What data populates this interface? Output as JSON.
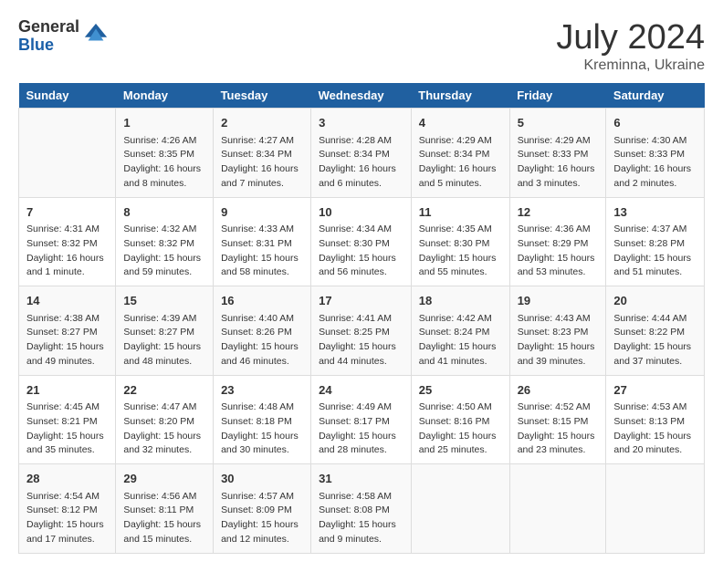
{
  "logo": {
    "general": "General",
    "blue": "Blue"
  },
  "title": "July 2024",
  "location": "Kreminna, Ukraine",
  "days_header": [
    "Sunday",
    "Monday",
    "Tuesday",
    "Wednesday",
    "Thursday",
    "Friday",
    "Saturday"
  ],
  "weeks": [
    [
      {
        "day": "",
        "info": ""
      },
      {
        "day": "1",
        "info": "Sunrise: 4:26 AM\nSunset: 8:35 PM\nDaylight: 16 hours\nand 8 minutes."
      },
      {
        "day": "2",
        "info": "Sunrise: 4:27 AM\nSunset: 8:34 PM\nDaylight: 16 hours\nand 7 minutes."
      },
      {
        "day": "3",
        "info": "Sunrise: 4:28 AM\nSunset: 8:34 PM\nDaylight: 16 hours\nand 6 minutes."
      },
      {
        "day": "4",
        "info": "Sunrise: 4:29 AM\nSunset: 8:34 PM\nDaylight: 16 hours\nand 5 minutes."
      },
      {
        "day": "5",
        "info": "Sunrise: 4:29 AM\nSunset: 8:33 PM\nDaylight: 16 hours\nand 3 minutes."
      },
      {
        "day": "6",
        "info": "Sunrise: 4:30 AM\nSunset: 8:33 PM\nDaylight: 16 hours\nand 2 minutes."
      }
    ],
    [
      {
        "day": "7",
        "info": "Sunrise: 4:31 AM\nSunset: 8:32 PM\nDaylight: 16 hours\nand 1 minute."
      },
      {
        "day": "8",
        "info": "Sunrise: 4:32 AM\nSunset: 8:32 PM\nDaylight: 15 hours\nand 59 minutes."
      },
      {
        "day": "9",
        "info": "Sunrise: 4:33 AM\nSunset: 8:31 PM\nDaylight: 15 hours\nand 58 minutes."
      },
      {
        "day": "10",
        "info": "Sunrise: 4:34 AM\nSunset: 8:30 PM\nDaylight: 15 hours\nand 56 minutes."
      },
      {
        "day": "11",
        "info": "Sunrise: 4:35 AM\nSunset: 8:30 PM\nDaylight: 15 hours\nand 55 minutes."
      },
      {
        "day": "12",
        "info": "Sunrise: 4:36 AM\nSunset: 8:29 PM\nDaylight: 15 hours\nand 53 minutes."
      },
      {
        "day": "13",
        "info": "Sunrise: 4:37 AM\nSunset: 8:28 PM\nDaylight: 15 hours\nand 51 minutes."
      }
    ],
    [
      {
        "day": "14",
        "info": "Sunrise: 4:38 AM\nSunset: 8:27 PM\nDaylight: 15 hours\nand 49 minutes."
      },
      {
        "day": "15",
        "info": "Sunrise: 4:39 AM\nSunset: 8:27 PM\nDaylight: 15 hours\nand 48 minutes."
      },
      {
        "day": "16",
        "info": "Sunrise: 4:40 AM\nSunset: 8:26 PM\nDaylight: 15 hours\nand 46 minutes."
      },
      {
        "day": "17",
        "info": "Sunrise: 4:41 AM\nSunset: 8:25 PM\nDaylight: 15 hours\nand 44 minutes."
      },
      {
        "day": "18",
        "info": "Sunrise: 4:42 AM\nSunset: 8:24 PM\nDaylight: 15 hours\nand 41 minutes."
      },
      {
        "day": "19",
        "info": "Sunrise: 4:43 AM\nSunset: 8:23 PM\nDaylight: 15 hours\nand 39 minutes."
      },
      {
        "day": "20",
        "info": "Sunrise: 4:44 AM\nSunset: 8:22 PM\nDaylight: 15 hours\nand 37 minutes."
      }
    ],
    [
      {
        "day": "21",
        "info": "Sunrise: 4:45 AM\nSunset: 8:21 PM\nDaylight: 15 hours\nand 35 minutes."
      },
      {
        "day": "22",
        "info": "Sunrise: 4:47 AM\nSunset: 8:20 PM\nDaylight: 15 hours\nand 32 minutes."
      },
      {
        "day": "23",
        "info": "Sunrise: 4:48 AM\nSunset: 8:18 PM\nDaylight: 15 hours\nand 30 minutes."
      },
      {
        "day": "24",
        "info": "Sunrise: 4:49 AM\nSunset: 8:17 PM\nDaylight: 15 hours\nand 28 minutes."
      },
      {
        "day": "25",
        "info": "Sunrise: 4:50 AM\nSunset: 8:16 PM\nDaylight: 15 hours\nand 25 minutes."
      },
      {
        "day": "26",
        "info": "Sunrise: 4:52 AM\nSunset: 8:15 PM\nDaylight: 15 hours\nand 23 minutes."
      },
      {
        "day": "27",
        "info": "Sunrise: 4:53 AM\nSunset: 8:13 PM\nDaylight: 15 hours\nand 20 minutes."
      }
    ],
    [
      {
        "day": "28",
        "info": "Sunrise: 4:54 AM\nSunset: 8:12 PM\nDaylight: 15 hours\nand 17 minutes."
      },
      {
        "day": "29",
        "info": "Sunrise: 4:56 AM\nSunset: 8:11 PM\nDaylight: 15 hours\nand 15 minutes."
      },
      {
        "day": "30",
        "info": "Sunrise: 4:57 AM\nSunset: 8:09 PM\nDaylight: 15 hours\nand 12 minutes."
      },
      {
        "day": "31",
        "info": "Sunrise: 4:58 AM\nSunset: 8:08 PM\nDaylight: 15 hours\nand 9 minutes."
      },
      {
        "day": "",
        "info": ""
      },
      {
        "day": "",
        "info": ""
      },
      {
        "day": "",
        "info": ""
      }
    ]
  ]
}
